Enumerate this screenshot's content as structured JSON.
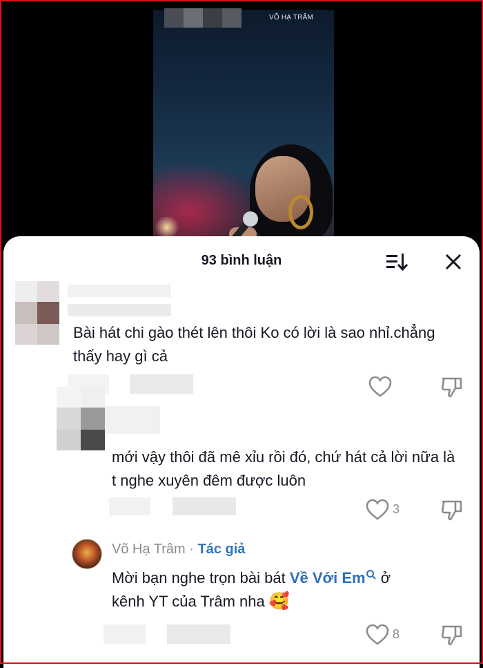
{
  "video": {
    "watermark": "VÕ HẠ TRÂM"
  },
  "sheet": {
    "title": "93 bình luận",
    "sort_icon": "sort-icon",
    "close_icon": "close-icon"
  },
  "comments": [
    {
      "text": "Bài hát chi gào thét lên thôi Ko có lời là sao nhỉ.chẳng thấy hay gì cả",
      "like_count": "",
      "replies": [
        {
          "text": "mới vậy thôi đã mê xỉu rồi đó, chứ hát cả lời nữa là t nghe xuyên đêm được luôn",
          "like_count": "3"
        },
        {
          "author": "Võ Hạ Trâm",
          "separator": " · ",
          "author_tag": "Tác giả",
          "text_before": "Mời bạn nghe trọn bài bát ",
          "song_link": "Về Với Em",
          "text_after": " ở",
          "text_line2": "kênh YT của Trâm nha",
          "emoji": "🥰",
          "like_count": "8"
        }
      ]
    }
  ],
  "colors": {
    "accent_link": "#2f6fb7",
    "text": "#161823",
    "muted": "#8a8b91",
    "frame": "#e0101a"
  }
}
